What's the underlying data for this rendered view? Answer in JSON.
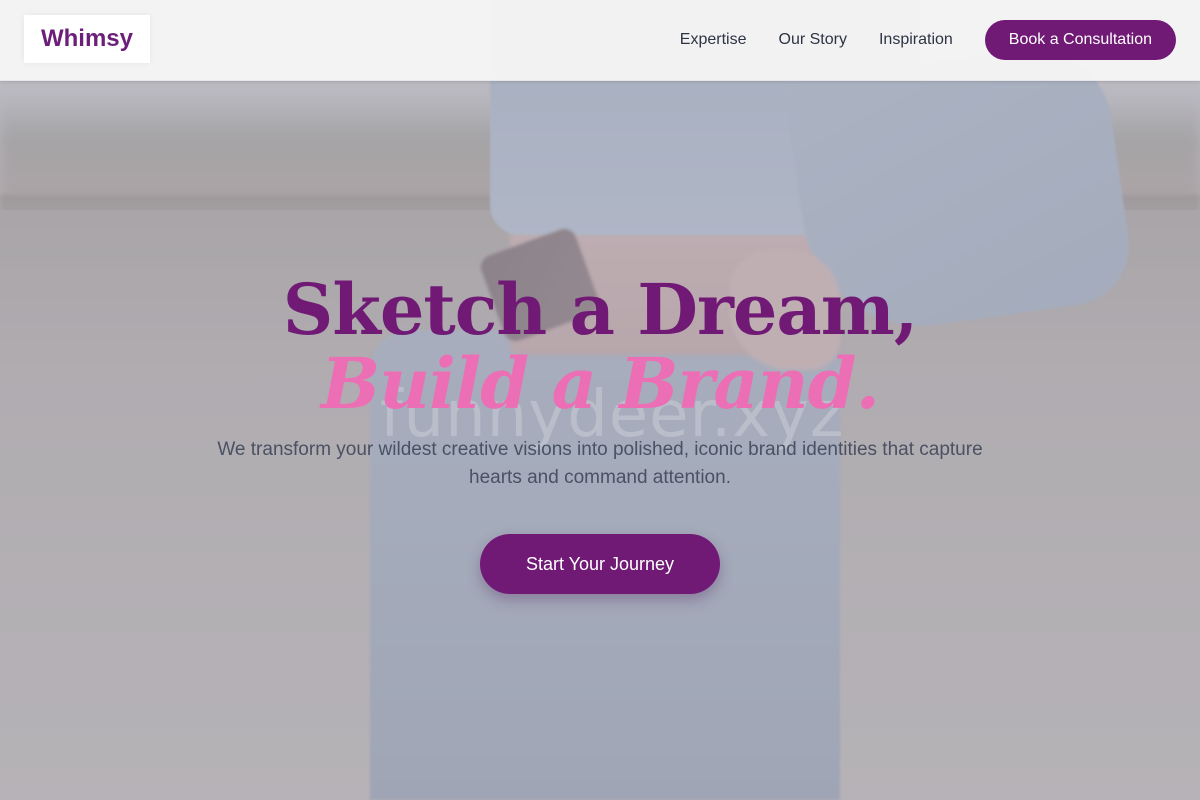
{
  "brand": {
    "logo_text": "Whimsy"
  },
  "nav": {
    "links": [
      "Expertise",
      "Our Story",
      "Inspiration"
    ],
    "cta_label": "Book a Consultation"
  },
  "hero": {
    "headline_line1": "Sketch a Dream,",
    "headline_line2": "Build a Brand.",
    "subtext": "We transform your wildest creative visions into polished, iconic brand identities that capture hearts and command attention.",
    "cta_label": "Start Your Journey",
    "watermark": "funnydeer.xyz"
  },
  "colors": {
    "primary": "#701a75",
    "accent_pink": "#ec6fb6",
    "nav_text": "#2e3444",
    "body_text": "#4a5163"
  }
}
